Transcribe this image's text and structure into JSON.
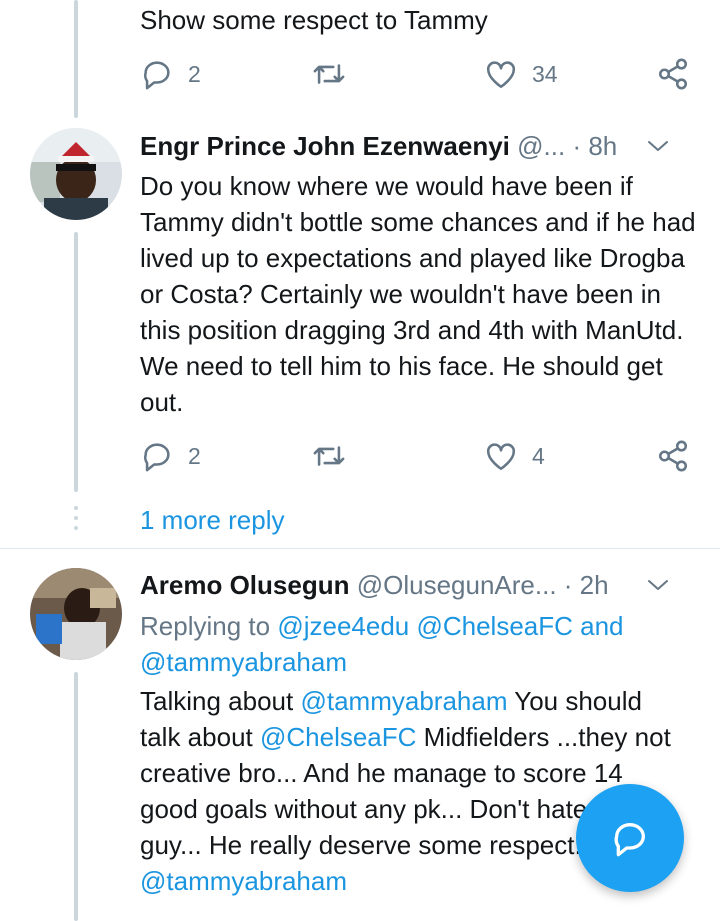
{
  "tweet_top": {
    "text": "Show some respect to Tammy",
    "replies": "2",
    "likes": "34"
  },
  "tweet_engr": {
    "name": "Engr Prince John Ezenwaenyi",
    "handle": "@...",
    "time": "· 8h",
    "text": "Do you know where we would have been if Tammy didn't bottle some chances and if he had lived up to expectations and played like Drogba or Costa? Certainly we wouldn't have been in this position dragging 3rd and 4th with ManUtd. We need to tell him to his face. He should get out.",
    "replies": "2",
    "likes": "4"
  },
  "thread": {
    "more_reply": "1 more reply"
  },
  "tweet_aremo": {
    "name": "Aremo Olusegun",
    "handle": "@OlusegunAre...",
    "time": "· 2h",
    "replying_to_label": "Replying to",
    "replying_to_users": "@jzee4edu @ChelseaFC and @tammyabraham",
    "text_1": "Talking about",
    "mention_1": "@tammyabraham",
    "text_2": "You should talk about",
    "mention_2": "@ChelseaFC",
    "text_3": "Midfielders ...they not creative bro... And he manage to score 14 good goals without any pk... Don't hate this guy... He really deserve some respect...",
    "mention_3": "@tammyabraham"
  },
  "icons": {
    "reply": "reply-icon",
    "retweet": "retweet-icon",
    "like": "heart-icon",
    "share": "share-icon",
    "menu": "chevron-down-icon",
    "compose": "compose-reply-icon"
  },
  "colors": {
    "link": "#1b95e0",
    "icon": "#657786",
    "fab": "#1da1f2",
    "thread_line": "#ccd6dd"
  }
}
